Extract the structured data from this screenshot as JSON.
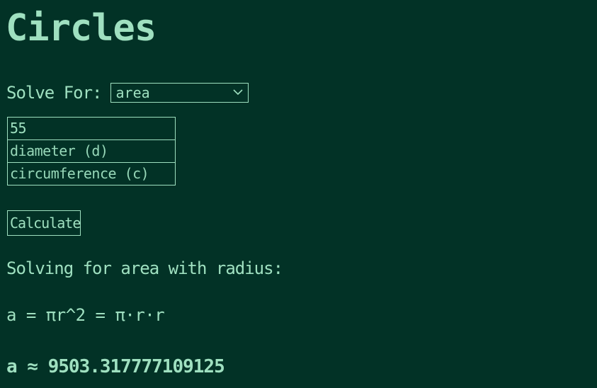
{
  "title": "Circles",
  "solve_for": {
    "label": "Solve For:",
    "selected": "area"
  },
  "inputs": {
    "radius_value": "55",
    "diameter_placeholder": "diameter (d)",
    "circumference_placeholder": "circumference (c)"
  },
  "calculate_label": "Calculate",
  "output": {
    "solving_text": "Solving for area with radius:",
    "formula": "a = πr^2 = π·r·r",
    "result": "a ≈ 9503.317777109125"
  },
  "icons": {
    "dropdown": "chevron-down-icon"
  },
  "colors": {
    "background": "#023226",
    "foreground": "#9fe0c0"
  }
}
